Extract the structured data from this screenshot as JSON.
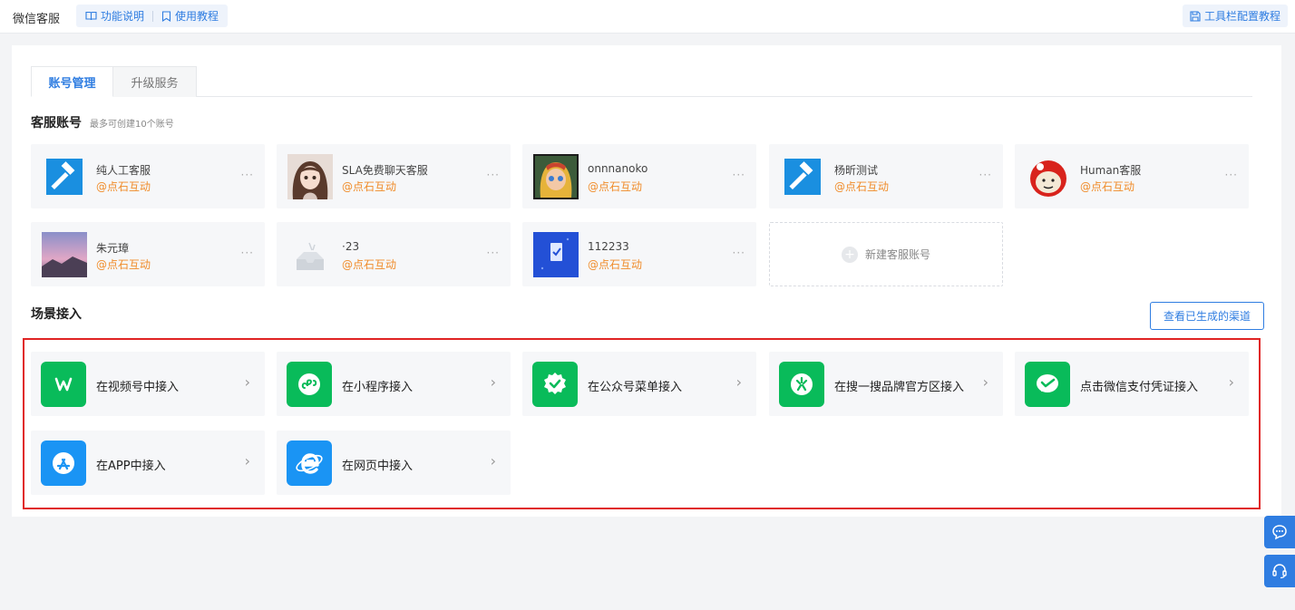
{
  "header": {
    "title": "微信客服",
    "links": [
      "功能说明",
      "使用教程"
    ],
    "right_link": "工具栏配置教程"
  },
  "tabs": [
    "账号管理",
    "升级服务"
  ],
  "accounts_section": {
    "title": "客服账号",
    "subtitle": "最多可创建10个账号"
  },
  "accounts": [
    {
      "name": "纯人工客服",
      "org": "@点石互动",
      "more": "···",
      "avatar": "hammer-logo"
    },
    {
      "name": "SLA免费聊天客服",
      "org": "@点石互动",
      "more": "···",
      "avatar": "anime-girl-photo"
    },
    {
      "name": "onnnanoko",
      "org": "@点石互动",
      "more": "···",
      "avatar": "cartoon-girl-photo"
    },
    {
      "name": "杨昕测试",
      "org": "@点石互动",
      "more": "···",
      "avatar": "hammer-logo"
    },
    {
      "name": "Human客服",
      "org": "@点石互动",
      "more": "···",
      "avatar": "red-helmet-cartoon"
    },
    {
      "name": "朱元璋",
      "org": "@点石互动",
      "more": "···",
      "avatar": "pink-sky-photo"
    },
    {
      "name": "·23",
      "org": "@点石互动",
      "more": "···",
      "avatar": "empty-box"
    },
    {
      "name": "112233",
      "org": "@点石互动",
      "more": "···",
      "avatar": "blue-phone-photo"
    }
  ],
  "new_account_label": "新建客服账号",
  "scenes_section": {
    "title": "场景接入",
    "view_button": "查看已生成的渠道"
  },
  "scenes": [
    {
      "label": "在视频号中接入",
      "icon": "channels-icon",
      "color": "#09bb5a"
    },
    {
      "label": "在小程序接入",
      "icon": "mini-program-icon",
      "color": "#09bb5a"
    },
    {
      "label": "在公众号菜单接入",
      "icon": "official-account-icon",
      "color": "#09bb5a"
    },
    {
      "label": "在搜一搜品牌官方区接入",
      "icon": "search-search-icon",
      "color": "#09bb5a"
    },
    {
      "label": "点击微信支付凭证接入",
      "icon": "wechat-pay-icon",
      "color": "#09bb5a"
    },
    {
      "label": "在APP中接入",
      "icon": "app-store-icon",
      "color": "#1a94f4"
    },
    {
      "label": "在网页中接入",
      "icon": "browser-icon",
      "color": "#1a94f4"
    }
  ],
  "colors": {
    "accent": "#2f7de1",
    "org_text": "#f08c2a",
    "highlight_border": "#e02424"
  }
}
